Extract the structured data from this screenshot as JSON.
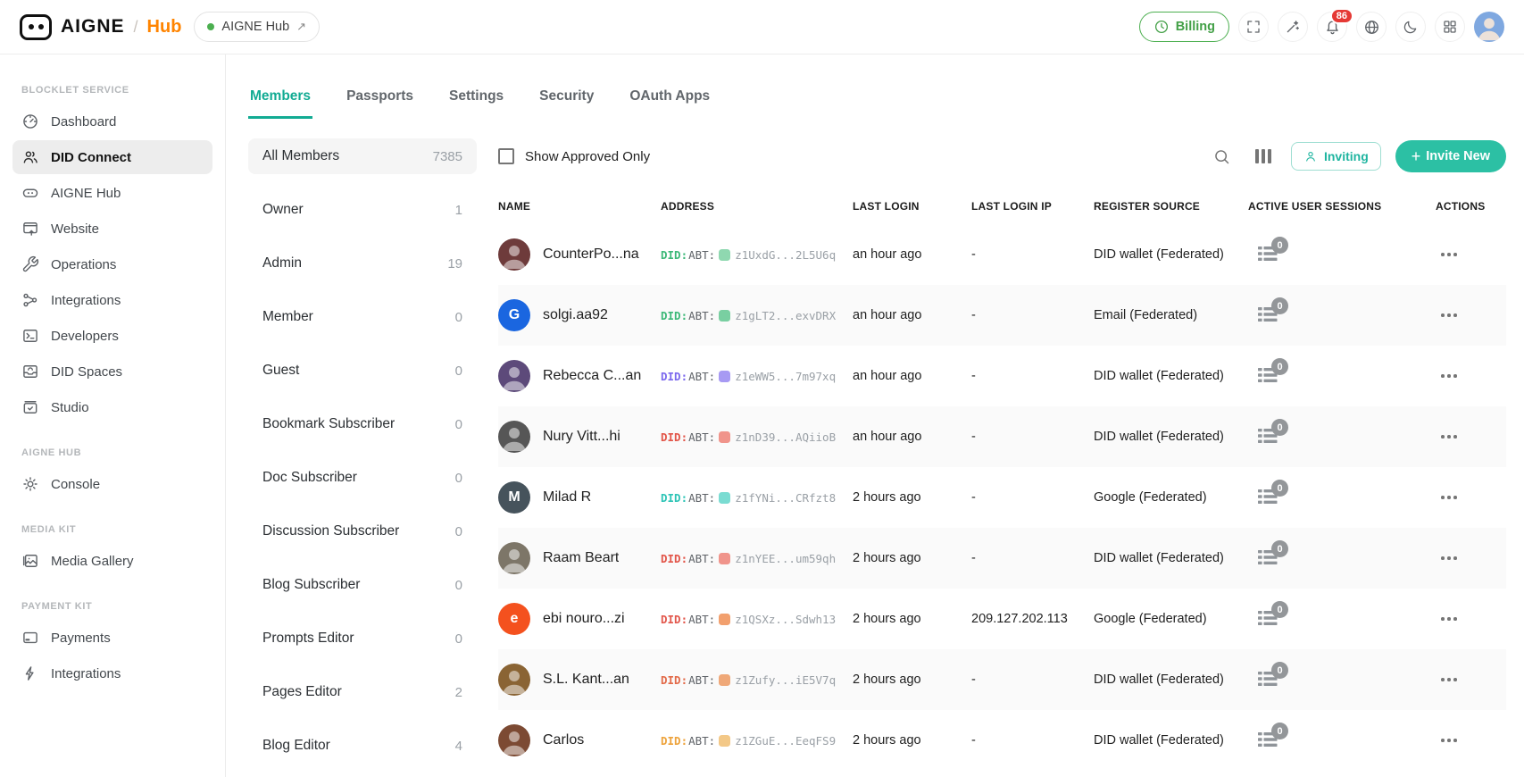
{
  "header": {
    "logo": {
      "brand": "AIGNE",
      "separator": "/",
      "product": "Hub"
    },
    "app_pill": {
      "label": "AIGNE Hub",
      "arrow": "↗"
    },
    "billing_label": "Billing",
    "notification_count": "86",
    "icons": [
      "clock-icon",
      "fullscreen-icon",
      "magic-wand-icon",
      "bell-icon",
      "globe-icon",
      "moon-icon",
      "apps-grid-icon",
      "avatar"
    ]
  },
  "colors": {
    "accent_tab": "#12ab93",
    "accent_button": "#2cc0a4",
    "billing_green": "#43a047",
    "badge_red": "#e53935",
    "logo_orange": "#ff8400",
    "stripe": "#fafafa"
  },
  "sidebar": {
    "sections": [
      {
        "label": "BLOCKLET SERVICE",
        "items": [
          {
            "label": "Dashboard",
            "icon": "dashboard-icon",
            "active": false
          },
          {
            "label": "DID Connect",
            "icon": "users-icon",
            "active": true
          },
          {
            "label": "AIGNE Hub",
            "icon": "robot-icon",
            "active": false
          },
          {
            "label": "Website",
            "icon": "browser-icon",
            "active": false
          },
          {
            "label": "Operations",
            "icon": "wrench-icon",
            "active": false
          },
          {
            "label": "Integrations",
            "icon": "share-nodes-icon",
            "active": false
          },
          {
            "label": "Developers",
            "icon": "terminal-icon",
            "active": false
          },
          {
            "label": "DID Spaces",
            "icon": "inbox-icon",
            "active": false
          },
          {
            "label": "Studio",
            "icon": "calendar-check-icon",
            "active": false
          }
        ]
      },
      {
        "label": "AIGNE HUB",
        "items": [
          {
            "label": "Console",
            "icon": "gear-icon",
            "active": false
          }
        ]
      },
      {
        "label": "MEDIA KIT",
        "items": [
          {
            "label": "Media Gallery",
            "icon": "image-icon",
            "active": false
          }
        ]
      },
      {
        "label": "PAYMENT KIT",
        "items": [
          {
            "label": "Payments",
            "icon": "credit-card-icon",
            "active": false
          },
          {
            "label": "Integrations",
            "icon": "bolt-icon",
            "active": false
          }
        ]
      }
    ]
  },
  "tabs": [
    {
      "label": "Members",
      "active": true
    },
    {
      "label": "Passports",
      "active": false
    },
    {
      "label": "Settings",
      "active": false
    },
    {
      "label": "Security",
      "active": false
    },
    {
      "label": "OAuth Apps",
      "active": false
    }
  ],
  "roles": [
    {
      "label": "All Members",
      "count": "7385",
      "active": true
    },
    {
      "label": "Owner",
      "count": "1",
      "active": false
    },
    {
      "label": "Admin",
      "count": "19",
      "active": false
    },
    {
      "label": "Member",
      "count": "0",
      "active": false
    },
    {
      "label": "Guest",
      "count": "0",
      "active": false
    },
    {
      "label": "Bookmark Subscriber",
      "count": "0",
      "active": false
    },
    {
      "label": "Doc Subscriber",
      "count": "0",
      "active": false
    },
    {
      "label": "Discussion Subscriber",
      "count": "0",
      "active": false
    },
    {
      "label": "Blog Subscriber",
      "count": "0",
      "active": false
    },
    {
      "label": "Prompts Editor",
      "count": "0",
      "active": false
    },
    {
      "label": "Pages Editor",
      "count": "2",
      "active": false
    },
    {
      "label": "Blog Editor",
      "count": "4",
      "active": false
    }
  ],
  "toolbar": {
    "checkbox_label": "Show Approved Only",
    "checkbox_checked": false,
    "search_icon": "search-icon",
    "columns_icon": "view-columns-icon",
    "inviting_label": "Inviting",
    "invite_new_label": "Invite New",
    "invite_new_plus": "+"
  },
  "table": {
    "columns": [
      "NAME",
      "ADDRESS",
      "LAST LOGIN",
      "LAST LOGIN IP",
      "REGISTER SOURCE",
      "ACTIVE USER SESSIONS",
      "ACTIONS"
    ],
    "rows": [
      {
        "name": "CounterPo...na",
        "avatar": {
          "bg": "#6e3b3b",
          "initial": ""
        },
        "did_prefix": "DID:",
        "abt_prefix": "ABT:",
        "did_color": "#3cb878",
        "identicon": "#8fd8b0",
        "address": "z1UxdG...2L5U6q",
        "last_login": "an hour ago",
        "last_login_ip": "-",
        "register_source": "DID wallet (Federated)",
        "sessions": "0"
      },
      {
        "name": "solgi.aa92",
        "avatar": {
          "bg": "#1a66e0",
          "initial": "G"
        },
        "did_prefix": "DID:",
        "abt_prefix": "ABT:",
        "did_color": "#3cb878",
        "identicon": "#79cfa1",
        "address": "z1gLT2...exvDRX",
        "last_login": "an hour ago",
        "last_login_ip": "-",
        "register_source": "Email (Federated)",
        "sessions": "0"
      },
      {
        "name": "Rebecca C...an",
        "avatar": {
          "bg": "#5d4a7a",
          "initial": ""
        },
        "did_prefix": "DID:",
        "abt_prefix": "ABT:",
        "did_color": "#7b68ee",
        "identicon": "#a79af3",
        "address": "z1eWW5...7m97xq",
        "last_login": "an hour ago",
        "last_login_ip": "-",
        "register_source": "DID wallet (Federated)",
        "sessions": "0"
      },
      {
        "name": "Nury Vitt...hi",
        "avatar": {
          "bg": "#565656",
          "initial": ""
        },
        "did_prefix": "DID:",
        "abt_prefix": "ABT:",
        "did_color": "#e25549",
        "identicon": "#f0948b",
        "address": "z1nD39...AQiioB",
        "last_login": "an hour ago",
        "last_login_ip": "-",
        "register_source": "DID wallet (Federated)",
        "sessions": "0"
      },
      {
        "name": "Milad R",
        "avatar": {
          "bg": "#46535c",
          "initial": "M"
        },
        "did_prefix": "DID:",
        "abt_prefix": "ABT:",
        "did_color": "#2ec4b6",
        "identicon": "#7adcd2",
        "address": "z1fYNi...CRfzt8",
        "last_login": "2 hours ago",
        "last_login_ip": "-",
        "register_source": "Google (Federated)",
        "sessions": "0"
      },
      {
        "name": "Raam Beart",
        "avatar": {
          "bg": "#7d7668",
          "initial": ""
        },
        "did_prefix": "DID:",
        "abt_prefix": "ABT:",
        "did_color": "#e25549",
        "identicon": "#f0948b",
        "address": "z1nYEE...um59qh",
        "last_login": "2 hours ago",
        "last_login_ip": "-",
        "register_source": "DID wallet (Federated)",
        "sessions": "0"
      },
      {
        "name": "ebi nouro...zi",
        "avatar": {
          "bg": "#f4511e",
          "initial": "e"
        },
        "did_prefix": "DID:",
        "abt_prefix": "ABT:",
        "did_color": "#e2574c",
        "identicon": "#f2a06e",
        "address": "z1QSXz...Sdwh13",
        "last_login": "2 hours ago",
        "last_login_ip": "209.127.202.113",
        "register_source": "Google (Federated)",
        "sessions": "0"
      },
      {
        "name": "S.L. Kant...an",
        "avatar": {
          "bg": "#8a6434",
          "initial": ""
        },
        "did_prefix": "DID:",
        "abt_prefix": "ABT:",
        "did_color": "#e26a49",
        "identicon": "#efa878",
        "address": "z1Zufy...iE5V7q",
        "last_login": "2 hours ago",
        "last_login_ip": "-",
        "register_source": "DID wallet (Federated)",
        "sessions": "0"
      },
      {
        "name": "Carlos",
        "avatar": {
          "bg": "#7c4a33",
          "initial": ""
        },
        "did_prefix": "DID:",
        "abt_prefix": "ABT:",
        "did_color": "#eda33c",
        "identicon": "#f3c887",
        "address": "z1ZGuE...EeqFS9",
        "last_login": "2 hours ago",
        "last_login_ip": "-",
        "register_source": "DID wallet (Federated)",
        "sessions": "0"
      }
    ]
  }
}
